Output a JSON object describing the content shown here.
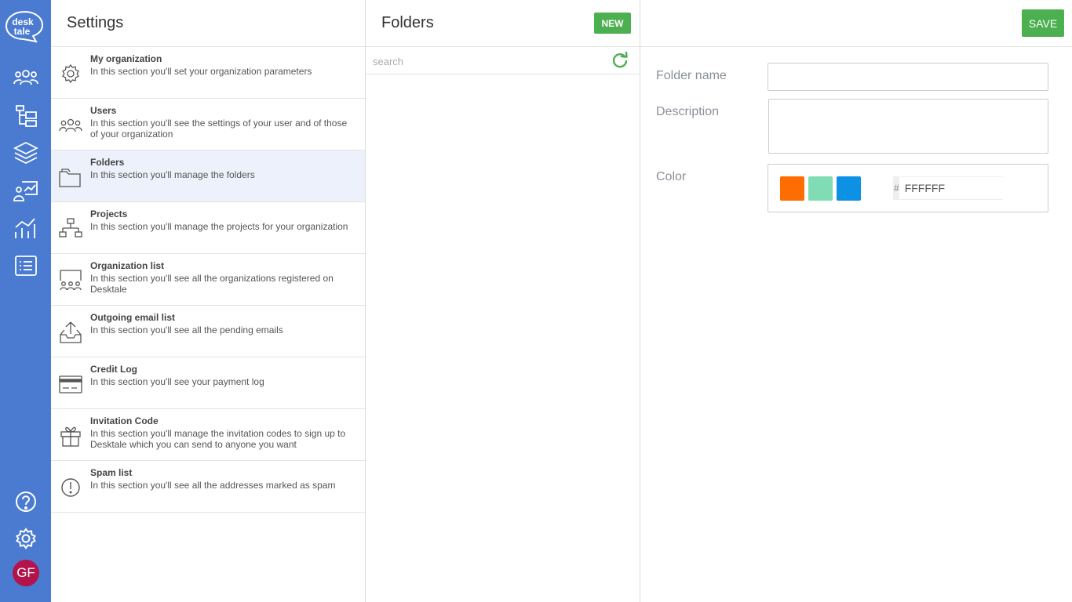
{
  "rail": {
    "logo_line1": "desk",
    "logo_line2": "tale",
    "avatar_initials": "GF",
    "avatar_color": "#b3134a",
    "accent": "#4a7bd1"
  },
  "settings": {
    "title": "Settings",
    "items": [
      {
        "icon": "gear-icon",
        "title": "My organization",
        "desc": "In this section you'll set your organization parameters"
      },
      {
        "icon": "users-icon",
        "title": "Users",
        "desc": "In this section you'll see the settings of your user and of those of your organization"
      },
      {
        "icon": "folder-icon",
        "title": "Folders",
        "desc": "In this section you'll manage the folders"
      },
      {
        "icon": "sitemap-icon",
        "title": "Projects",
        "desc": "In this section you'll manage the projects for your organization"
      },
      {
        "icon": "organization-icon",
        "title": "Organization list",
        "desc": "In this section you'll see all the organizations registered on Desktale"
      },
      {
        "icon": "outbox-icon",
        "title": "Outgoing email list",
        "desc": "In this section you'll see all the pending emails"
      },
      {
        "icon": "credit-card-icon",
        "title": "Credit Log",
        "desc": "In this section you'll see your payment log"
      },
      {
        "icon": "gift-icon",
        "title": "Invitation Code",
        "desc": "In this section you'll manage the invitation codes to sign up to Desktale which you can send to anyone you want"
      },
      {
        "icon": "alert-icon",
        "title": "Spam list",
        "desc": "In this section you'll see all the addresses marked as spam"
      }
    ],
    "active_item": "Folders"
  },
  "folders": {
    "title": "Folders",
    "new_label": "NEW",
    "search_placeholder": "search"
  },
  "detail": {
    "save_label": "SAVE",
    "folder_name_label": "Folder name",
    "folder_name_value": "",
    "description_label": "Description",
    "description_value": "",
    "color_label": "Color",
    "swatches": [
      "#ff6d00",
      "#7fdcb4",
      "#0d91e4"
    ],
    "hex_prefix": "#",
    "hex_value": "FFFFFF",
    "button_color": "#4caf50"
  }
}
